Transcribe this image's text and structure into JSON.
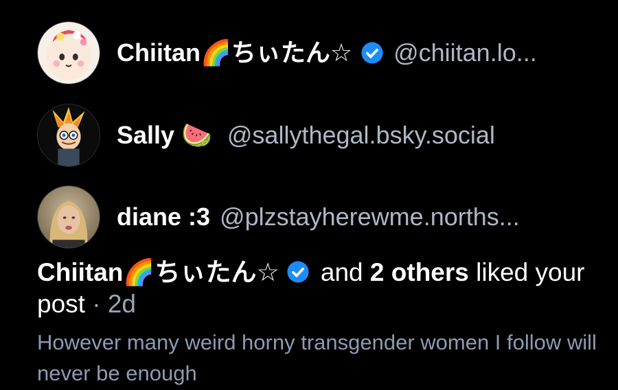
{
  "likers": [
    {
      "display_name": "Chiitan🌈ちぃたん☆",
      "verified": true,
      "handle": "@chiitan.lo..."
    },
    {
      "display_name": "Sally 🍉",
      "verified": false,
      "handle": "@sallythegal.bsky.social"
    },
    {
      "display_name": "diane :3",
      "verified": false,
      "handle": "@plzstayherewme.norths..."
    }
  ],
  "notification": {
    "actor_name": "Chiitan🌈ちぃたん☆",
    "and_text": "and",
    "others_text": "2 others",
    "liked_text": "liked your post",
    "separator": "·",
    "time_ago": "2d"
  },
  "post": {
    "text": "However many weird horny transgender women I follow will never be enough"
  },
  "colors": {
    "background": "#000000",
    "handle": "#aeb8c5",
    "muted": "#9aa6b4",
    "post_text": "#8d9bb0",
    "verified_badge": "#1d8cf8"
  },
  "icons": {
    "verified": "verified-check-icon"
  }
}
